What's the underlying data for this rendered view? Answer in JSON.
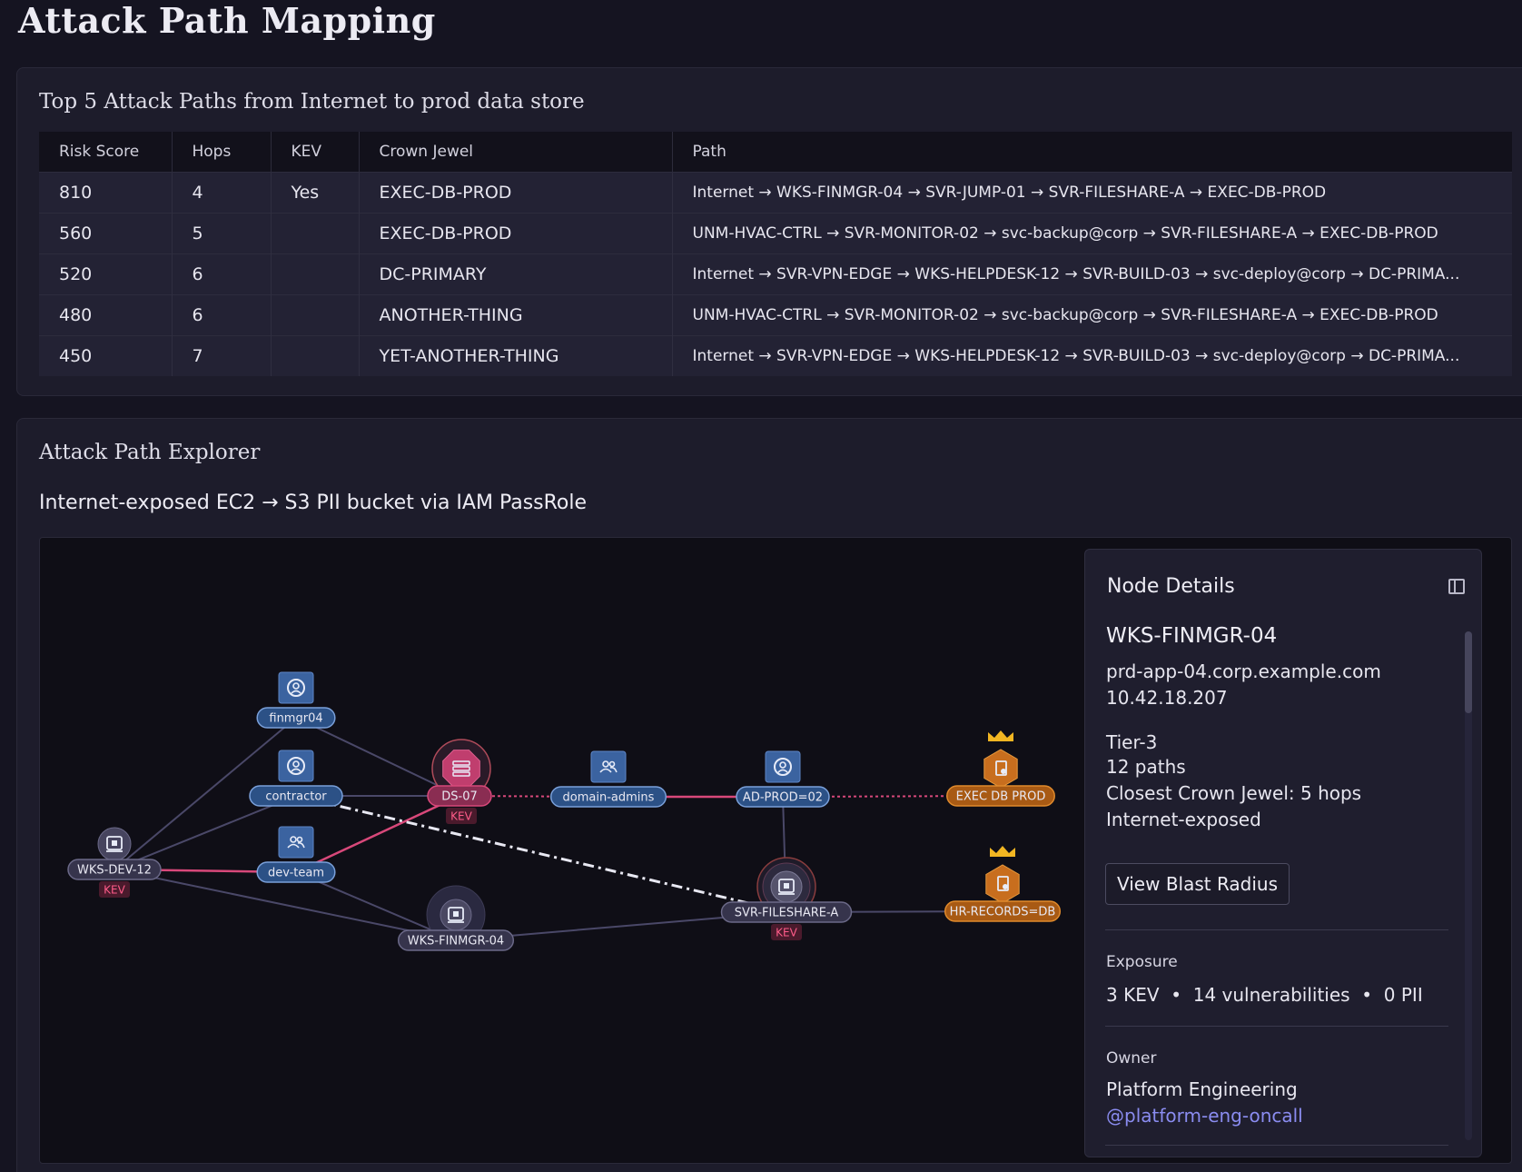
{
  "page": {
    "title": "Attack Path Mapping"
  },
  "paths_panel": {
    "title": "Top 5 Attack Paths from Internet to prod data store",
    "columns": [
      "Risk Score",
      "Hops",
      "KEV",
      "Crown Jewel",
      "Path"
    ],
    "rows": [
      {
        "risk": "810",
        "hops": "4",
        "kev": "Yes",
        "jewel": "EXEC-DB-PROD",
        "path": "Internet → WKS-FINMGR-04 → SVR-JUMP-01 → SVR-FILESHARE-A → EXEC-DB-PROD"
      },
      {
        "risk": "560",
        "hops": "5",
        "kev": "",
        "jewel": "EXEC-DB-PROD",
        "path": "UNM-HVAC-CTRL → SVR-MONITOR-02 → svc-backup@corp → SVR-FILESHARE-A → EXEC-DB-PROD"
      },
      {
        "risk": "520",
        "hops": "6",
        "kev": "",
        "jewel": "DC-PRIMARY",
        "path": "Internet → SVR-VPN-EDGE → WKS-HELPDESK-12 → SVR-BUILD-03 → svc-deploy@corp → DC-PRIMA..."
      },
      {
        "risk": "480",
        "hops": "6",
        "kev": "",
        "jewel": "ANOTHER-THING",
        "path": "UNM-HVAC-CTRL → SVR-MONITOR-02 → svc-backup@corp → SVR-FILESHARE-A → EXEC-DB-PROD"
      },
      {
        "risk": "450",
        "hops": "7",
        "kev": "",
        "jewel": "YET-ANOTHER-THING",
        "path": "Internet → SVR-VPN-EDGE → WKS-HELPDESK-12 → SVR-BUILD-03 → svc-deploy@corp → DC-PRIMA..."
      }
    ]
  },
  "explorer": {
    "title": "Attack Path Explorer",
    "subtitle": "Internet-exposed EC2 → S3 PII bucket via IAM PassRole",
    "kev_badge": "KEV",
    "colors": {
      "critical": "#d8487a",
      "edge": "#4a4868",
      "crown": "#d4781c",
      "node": "#3b63a0"
    },
    "nodes": [
      {
        "id": "wks-dev-12",
        "label": "WKS-DEV-12",
        "kind": "workstation",
        "kev": true
      },
      {
        "id": "finmgr04",
        "label": "finmgr04",
        "kind": "user",
        "kev": false
      },
      {
        "id": "contractor",
        "label": "contractor",
        "kind": "user",
        "kev": false
      },
      {
        "id": "dev-team",
        "label": "dev-team",
        "kind": "group",
        "kev": false
      },
      {
        "id": "ds-07",
        "label": "DS-07",
        "kind": "server-critical",
        "kev": true
      },
      {
        "id": "wks-finmgr-04",
        "label": "WKS-FINMGR-04",
        "kind": "workstation",
        "kev": false
      },
      {
        "id": "domain-admins",
        "label": "domain-admins",
        "kind": "group",
        "kev": false
      },
      {
        "id": "ad-prod-02",
        "label": "AD-PROD=02",
        "kind": "user",
        "kev": false
      },
      {
        "id": "svr-fileshare-a",
        "label": "SVR-FILESHARE-A",
        "kind": "server",
        "kev": true
      },
      {
        "id": "exec-db-prod",
        "label": "EXEC DB PROD",
        "kind": "crown",
        "kev": false
      },
      {
        "id": "hr-records-db",
        "label": "HR-RECORDS=DB",
        "kind": "crown",
        "kev": false
      }
    ],
    "edges": [
      {
        "from": "wks-dev-12",
        "to": "finmgr04",
        "style": "normal"
      },
      {
        "from": "wks-dev-12",
        "to": "contractor",
        "style": "normal"
      },
      {
        "from": "wks-dev-12",
        "to": "dev-team",
        "style": "critical"
      },
      {
        "from": "wks-dev-12",
        "to": "wks-finmgr-04",
        "style": "normal"
      },
      {
        "from": "finmgr04",
        "to": "ds-07",
        "style": "normal"
      },
      {
        "from": "contractor",
        "to": "ds-07",
        "style": "normal"
      },
      {
        "from": "dev-team",
        "to": "ds-07",
        "style": "critical"
      },
      {
        "from": "dev-team",
        "to": "wks-finmgr-04",
        "style": "normal"
      },
      {
        "from": "contractor",
        "to": "svr-fileshare-a",
        "style": "highlight"
      },
      {
        "from": "ds-07",
        "to": "domain-admins",
        "style": "critical-dotted"
      },
      {
        "from": "domain-admins",
        "to": "ad-prod-02",
        "style": "critical"
      },
      {
        "from": "ad-prod-02",
        "to": "exec-db-prod",
        "style": "critical-dotted"
      },
      {
        "from": "ad-prod-02",
        "to": "svr-fileshare-a",
        "style": "normal"
      },
      {
        "from": "wks-finmgr-04",
        "to": "svr-fileshare-a",
        "style": "normal"
      },
      {
        "from": "svr-fileshare-a",
        "to": "hr-records-db",
        "style": "normal"
      }
    ]
  },
  "details": {
    "title": "Node Details",
    "host": "WKS-FINMGR-04",
    "fqdn": "prd-app-04.corp.example.com",
    "ip": "10.42.18.207",
    "tier": "Tier-3",
    "paths": "12 paths",
    "closest": "Closest Crown Jewel: 5 hops",
    "exposure_flag": "Internet-exposed",
    "button": "View Blast Radius",
    "exposure_label": "Exposure",
    "exposure_value": "3 KEV  •  14 vulnerabilities  •  0 PII",
    "owner_label": "Owner",
    "owner_team": "Platform Engineering",
    "owner_handle": "@platform-eng-oncall"
  }
}
